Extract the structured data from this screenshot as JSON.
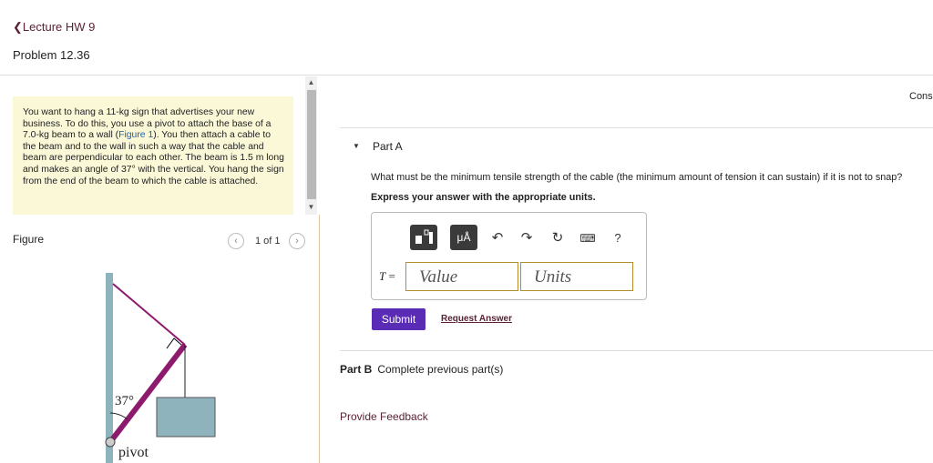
{
  "header": {
    "back_label": "Lecture HW 9",
    "problem_title": "Problem 12.36"
  },
  "problem": {
    "text_before_link": "You want to hang a 11-kg sign that advertises your new business. To do this, you use a pivot to attach the base of a 7.0-kg beam to a wall (",
    "figure_link": "Figure 1",
    "text_after_link": "). You then attach a cable to the beam and to the wall in such a way that the cable and beam are perpendicular to each other. The beam is 1.5 m long and makes an angle of 37° with the vertical. You hang the sign from the end of the beam to which the cable is attached."
  },
  "figure": {
    "label": "Figure",
    "count": "1 of 1",
    "angle_label": "37°",
    "pivot_label": "pivot",
    "colors": {
      "wall": "#8fb3bd",
      "beam": "#8e1a6e",
      "cable": "#8e1a6e",
      "sign": "#8fb3bd"
    }
  },
  "right": {
    "cons": "Cons",
    "part_a": {
      "label": "Part A",
      "question": "What must be the minimum tensile strength of the cable (the minimum amount of tension it can sustain) if it is not to snap?",
      "instruction": "Express your answer with the appropriate units.",
      "toolbar": {
        "units_btn": "μÅ",
        "help": "?"
      },
      "variable": "T",
      "equals": " =",
      "value_placeholder": "Value",
      "units_placeholder": "Units",
      "submit": "Submit",
      "request_answer": "Request Answer"
    },
    "part_b": {
      "label": "Part B",
      "text": "Complete previous part(s)"
    },
    "feedback": "Provide Feedback"
  },
  "icons": [
    "chevron-left-icon",
    "template-icon",
    "units-icon",
    "undo-icon",
    "redo-icon",
    "reset-icon",
    "keyboard-icon",
    "help-icon",
    "caret-down-icon"
  ]
}
